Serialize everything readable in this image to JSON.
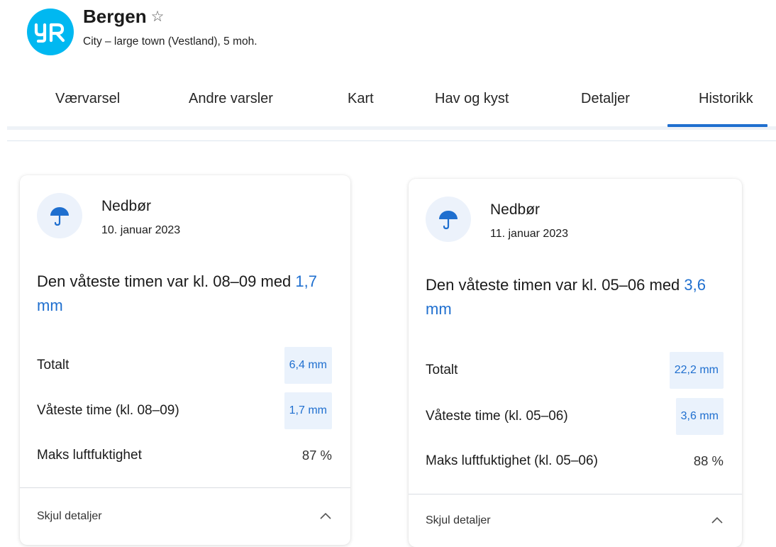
{
  "location": {
    "logo_text": "YR",
    "name": "Bergen",
    "star_icon": "☆",
    "subtitle": "City – large town (Vestland), 5 moh."
  },
  "tabs": [
    {
      "label": "Værvarsel",
      "active": false
    },
    {
      "label": "Andre varsler",
      "active": false
    },
    {
      "label": "Kart",
      "active": false
    },
    {
      "label": "Hav og kyst",
      "active": false
    },
    {
      "label": "Detaljer",
      "active": false
    },
    {
      "label": "Historikk",
      "active": true
    }
  ],
  "cards": [
    {
      "icon": "umbrella-icon",
      "title": "Nedbør",
      "date": "10. januar 2023",
      "headline_text": "Den våteste timen var kl. 08–09 med ",
      "headline_value": "1,7 mm",
      "rows": [
        {
          "label": "Totalt",
          "value": "6,4 mm"
        },
        {
          "label": "Våteste time (kl. 08–09)",
          "value": "1,7 mm"
        },
        {
          "label": "Maks luftfuktighet",
          "value": "87 %"
        }
      ],
      "footer_label": "Skjul detaljer"
    },
    {
      "icon": "umbrella-icon",
      "title": "Nedbør",
      "date": "11. januar 2023",
      "headline_text": "Den våteste timen var kl. 05–06 med ",
      "headline_value": "3,6 mm",
      "rows": [
        {
          "label": "Totalt",
          "value": "22,2 mm"
        },
        {
          "label": "Våteste time (kl. 05–06)",
          "value": "3,6 mm"
        },
        {
          "label": "Maks luftfuktighet (kl. 05–06)",
          "value": "88 %"
        }
      ],
      "footer_label": "Skjul detaljer"
    }
  ],
  "colors": {
    "logo_bg": "#00b8f1",
    "accent": "#1f6fcf",
    "pill_bg": "#eaf2fc",
    "icon_circle_bg": "#ecf2fb"
  }
}
